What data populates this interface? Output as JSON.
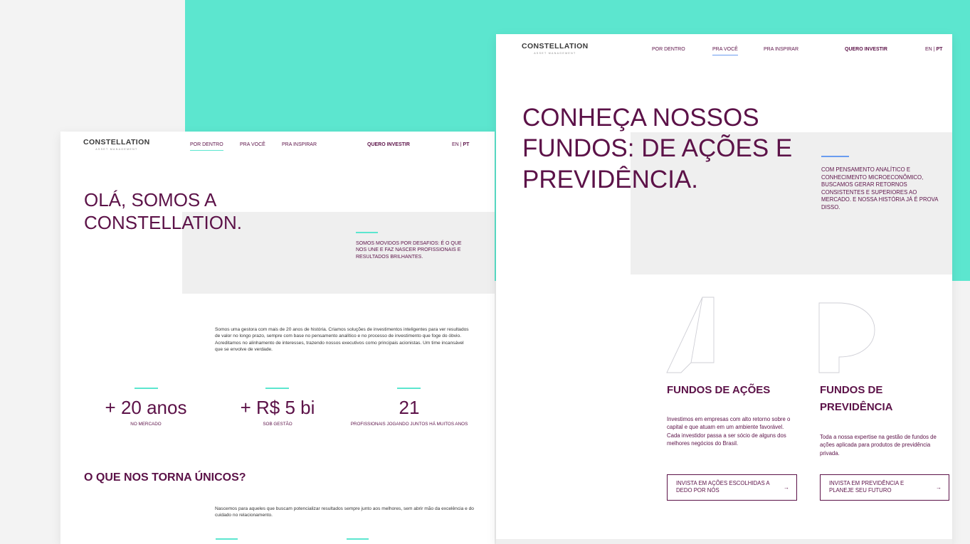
{
  "left_page": {
    "logo": {
      "brand": "CONSTELLATION",
      "sub": "ASSET MANAGEMENT"
    },
    "nav": [
      "POR DENTRO",
      "PRA VOCÊ",
      "PRA INSPIRAR"
    ],
    "invest": "QUERO INVESTIR",
    "lang": {
      "en": "EN",
      "sep": " | ",
      "pt": "PT"
    },
    "hero": [
      "OLÁ, SOMOS A",
      "CONSTELLATION."
    ],
    "panel_text": "SOMOS MOVIDOS POR DESAFIOS: É O QUE NOS UNE E FAZ NASCER PROFISSIONAIS E RESULTADOS BRILHANTES.",
    "intro": "Somos uma gestora com mais de 20 anos de história. Criamos soluções de investimentos inteligentes para ver resultados de valor no longo prazo, sempre com base no pensamento analítico e no processo de investimento que foge do óbvio. Acreditamos no alinhamento de interesses, trazendo nossos executivos como principais acionistas. Um time incansável que se envolve de verdade.",
    "stats": [
      {
        "value": "+ 20 anos",
        "caption": "NO MERCADO"
      },
      {
        "value": "+ R$ 5 bi",
        "caption": "SOB GESTÃO"
      },
      {
        "value": "21",
        "caption": "PROFISSIONAIS JOGANDO JUNTOS HÁ MUITOS ANOS"
      }
    ],
    "section_heading": "O QUE NOS TORNA ÚNICOS?",
    "section_text": "Nascemos para aqueles que buscam potencializar resultados sempre junto aos melhores, sem abrir mão da excelência e do cuidado no relacionamento."
  },
  "right_page": {
    "logo": {
      "brand": "CONSTELLATION",
      "sub": "ASSET MANAGEMENT"
    },
    "nav": [
      "POR DENTRO",
      "PRA VOCÊ",
      "PRA INSPIRAR"
    ],
    "invest": "QUERO INVESTIR",
    "lang": {
      "en": "EN",
      "sep": " | ",
      "pt": "PT"
    },
    "hero": [
      "CONHEÇA NOSSOS",
      "FUNDOS: DE AÇÕES E",
      "PREVIDÊNCIA."
    ],
    "panel_text": "COM PENSAMENTO ANALÍTICO E CONHECIMENTO MICROECONÔMICO, BUSCAMOS GERAR RETORNOS CONSISTENTES E SUPERIORES AO MERCADO. E NOSSA HISTÓRIA JÁ É PROVA DISSO.",
    "funds": [
      {
        "title": "FUNDOS DE AÇÕES",
        "desc": "Investimos em empresas com alto retorno sobre o capital e que atuam em um ambiente favorável. Cada investidor passa a ser sócio de alguns dos melhores negócios do Brasil.",
        "cta": "INVISTA EM AÇÕES ESCOLHIDAS A DEDO POR NÓS"
      },
      {
        "title": "FUNDOS DE PREVIDÊNCIA",
        "desc": "Toda a nossa expertise na gestão de fundos de ações aplicada para produtos de previdência privada.",
        "cta": "INVISTA EM PREVIDÊNCIA E PLANEJE SEU FUTURO"
      }
    ],
    "arrow": "→"
  },
  "colors": {
    "brand": "#5c1248",
    "teal": "#5ce6cf",
    "blue_accent": "#6a9cf0",
    "grey_panel": "#efefef"
  }
}
